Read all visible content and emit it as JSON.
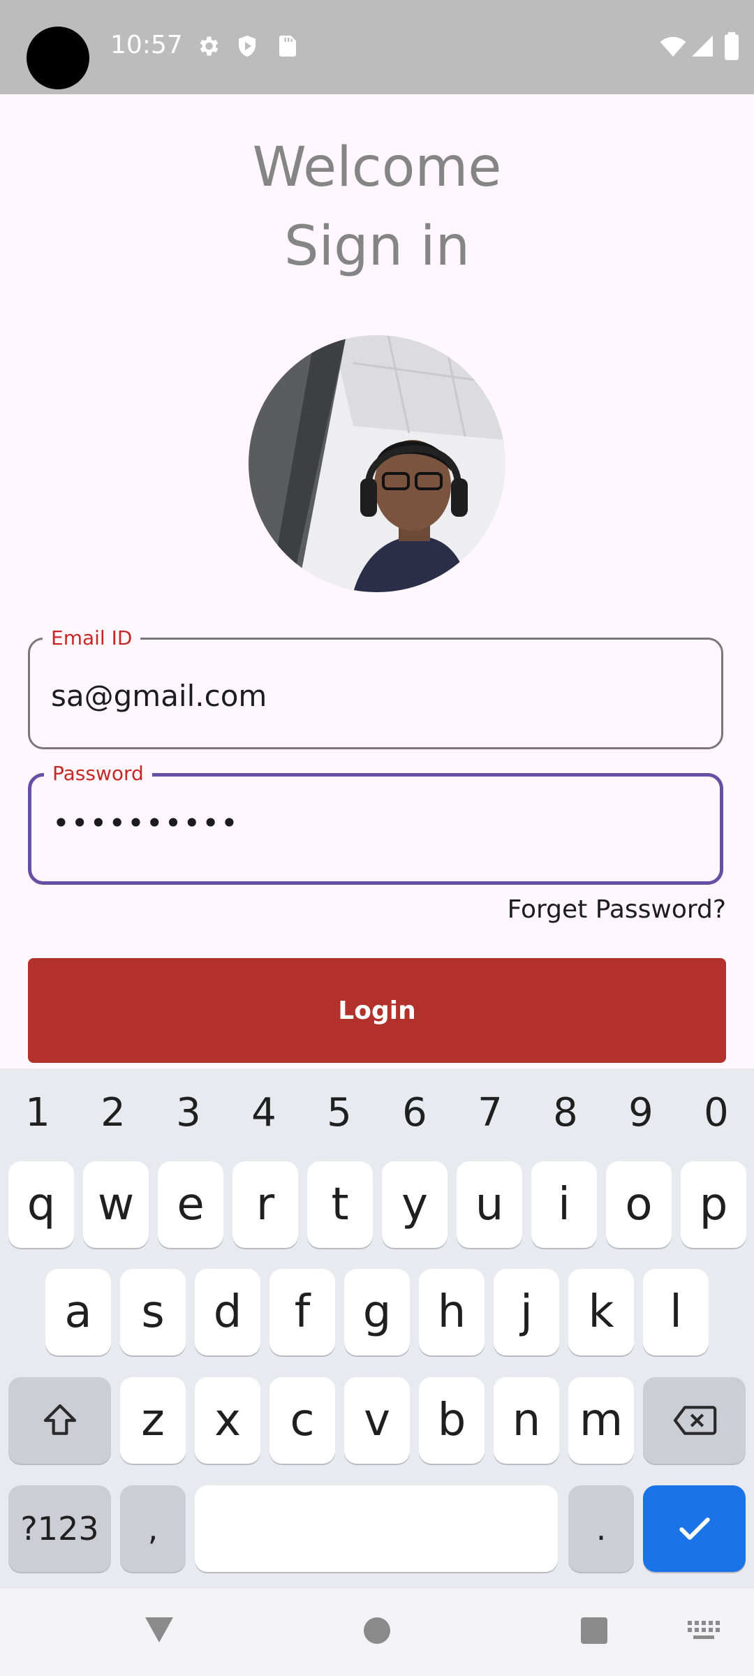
{
  "status_bar": {
    "time": "10:57",
    "icons_left": [
      "settings-gear-icon",
      "shield-play-icon",
      "sd-card-icon"
    ],
    "icons_right": [
      "wifi-icon",
      "cell-signal-icon",
      "battery-icon"
    ]
  },
  "header": {
    "welcome": "Welcome",
    "signin": "Sign in"
  },
  "form": {
    "email_label": "Email ID",
    "email_value": "sa@gmail.com",
    "password_label": "Password",
    "password_value": "••••••••••",
    "forgot_label": "Forget Password?",
    "login_label": "Login"
  },
  "keyboard": {
    "numbers": [
      "1",
      "2",
      "3",
      "4",
      "5",
      "6",
      "7",
      "8",
      "9",
      "0"
    ],
    "row1": [
      "q",
      "w",
      "e",
      "r",
      "t",
      "y",
      "u",
      "i",
      "o",
      "p"
    ],
    "row2": [
      "a",
      "s",
      "d",
      "f",
      "g",
      "h",
      "j",
      "k",
      "l"
    ],
    "row3": [
      "z",
      "x",
      "c",
      "v",
      "b",
      "n",
      "m"
    ],
    "symbols_label": "?123",
    "comma": ",",
    "period": "."
  },
  "colors": {
    "accent": "#6750a4",
    "error_label": "#c62828",
    "login_button": "#b3312b",
    "enter_key": "#1b73e8"
  }
}
